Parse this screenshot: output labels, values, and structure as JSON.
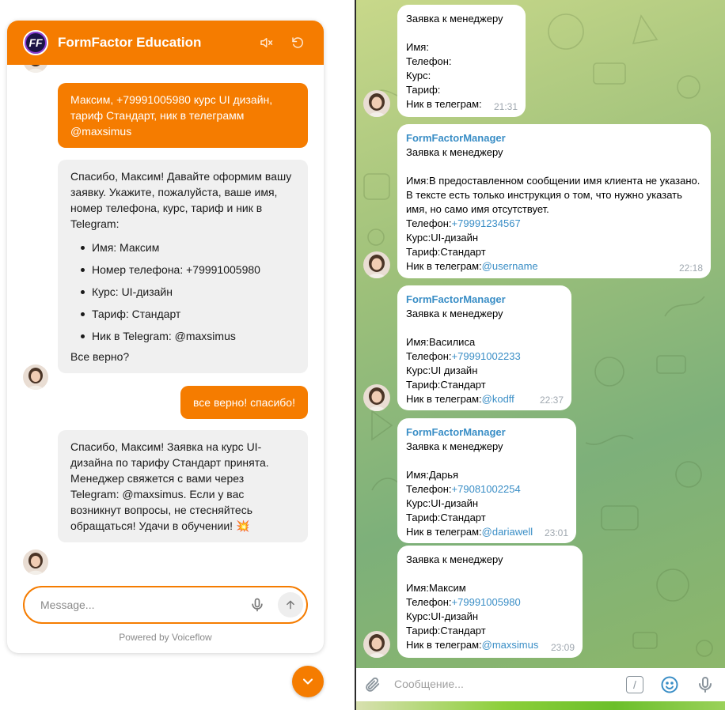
{
  "widget": {
    "title": "FormFactor Education",
    "logo_text": "FF",
    "accent_color": "#f57c00",
    "icons": {
      "mute": "volume-off-icon",
      "reset": "refresh-icon",
      "mic": "microphone-icon",
      "send": "arrow-up-icon",
      "scroll": "chevron-down-icon"
    },
    "messages": {
      "user_1": "Максим, +79991005980 курс UI дизайн, тариф Стандарт, ник в телеграмм @maxsimus",
      "bot_1_intro": "Спасибо, Максим! Давайте оформим вашу заявку. Укажите, пожалуйста, ваше имя, номер телефона, курс, тариф и ник в Telegram:",
      "bot_1_items": [
        "Имя: Максим",
        "Номер телефона: +79991005980",
        "Курс: UI-дизайн",
        "Тариф: Стандарт",
        "Ник в Telegram: @maxsimus"
      ],
      "bot_1_outro": "Все верно?",
      "user_2": "все верно! спасибо!",
      "bot_2": "Спасибо, Максим! Заявка на курс UI-дизайна по тарифу Стандарт принята. Менеджер свяжется с вами через Telegram: @maxsimus. Если у вас возникнут вопросы, не стесняйтесь обращаться! Удачи в обучении! 💥"
    },
    "input_placeholder": "Message...",
    "powered_by": "Powered by Voiceflow"
  },
  "telegram": {
    "input_placeholder": "Сообщение...",
    "cmd_glyph": "/",
    "messages": [
      {
        "sender": "",
        "title": "Заявка к менеджеру",
        "name_label": "Имя:",
        "name": "",
        "phone_label": "Телефон:",
        "phone": "",
        "course_label": "Курс:",
        "course": "",
        "tariff_label": "Тариф:",
        "tariff": "",
        "nick_label": "Ник в телеграм:",
        "nick": "",
        "time": "21:31"
      },
      {
        "sender": "FormFactorManager",
        "title": "Заявка к менеджеру",
        "name_label": "Имя:",
        "name": "В предоставленном сообщении имя клиента не указано. В тексте есть только инструкция о том, что нужно указать имя, но само имя отсутствует.",
        "phone_label": "Телефон:",
        "phone": "+79991234567",
        "course_label": "Курс:",
        "course": "UI-дизайн",
        "tariff_label": "Тариф:",
        "tariff": "Стандарт",
        "nick_label": "Ник в телеграм:",
        "nick": "@username",
        "time": "22:18"
      },
      {
        "sender": "FormFactorManager",
        "title": "Заявка к менеджеру",
        "name_label": "Имя:",
        "name": "Василиса",
        "phone_label": "Телефон:",
        "phone": "+79991002233",
        "course_label": "Курс:",
        "course": "UI дизайн",
        "tariff_label": "Тариф:",
        "tariff": "Стандарт",
        "nick_label": "Ник в телеграм:",
        "nick": "@kodff",
        "time": "22:37"
      },
      {
        "sender": "FormFactorManager",
        "title": "Заявка к менеджеру",
        "name_label": "Имя:",
        "name": "Дарья",
        "phone_label": "Телефон:",
        "phone": "+79081002254",
        "course_label": "Курс:",
        "course": "UI-дизайн",
        "tariff_label": "Тариф:",
        "tariff": "Стандарт",
        "nick_label": "Ник в телеграм:",
        "nick": "@dariawell",
        "time": "23:01"
      },
      {
        "sender": "",
        "title": "Заявка к менеджеру",
        "name_label": "Имя:",
        "name": "Максим",
        "phone_label": "Телефон:",
        "phone": "+79991005980",
        "course_label": "Курс:",
        "course": "UI-дизайн",
        "tariff_label": "Тариф:",
        "tariff": "Стандарт",
        "nick_label": "Ник в телеграм:",
        "nick": "@maxsimus",
        "time": "23:09"
      }
    ]
  }
}
